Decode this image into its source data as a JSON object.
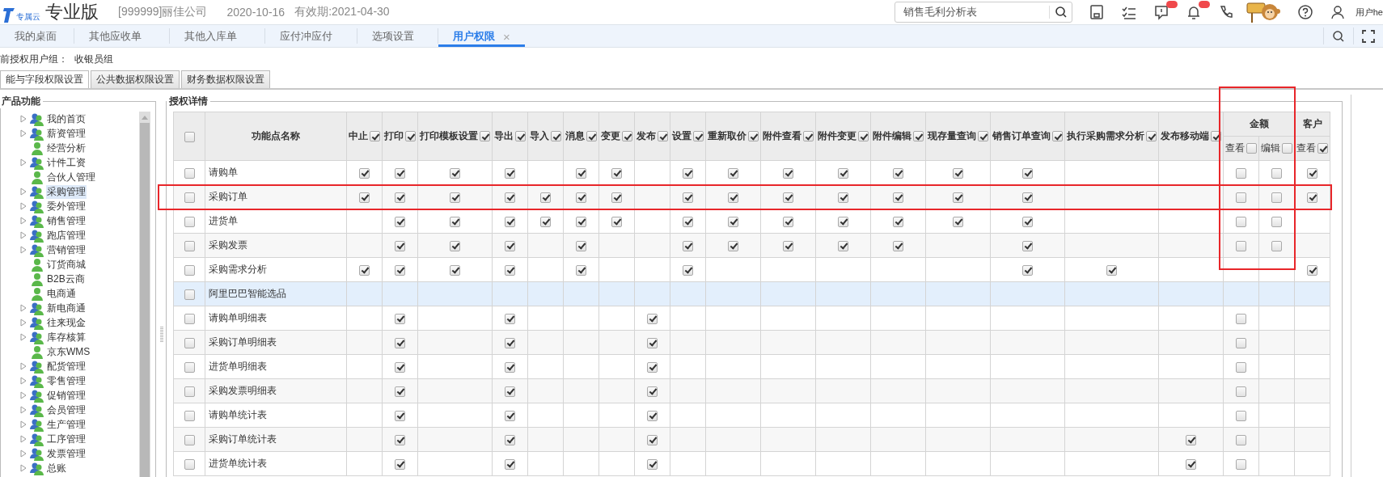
{
  "header": {
    "logo_caption": "专属云",
    "edition": "专业版",
    "company": "[999999]丽佳公司",
    "date": "2020-10-16",
    "validity": "有效期:2021-04-30",
    "search": {
      "value": "销售毛利分析表"
    },
    "user": "用户he"
  },
  "tabs": [
    {
      "label": "我的桌面",
      "selected": false,
      "closable": false
    },
    {
      "label": "其他应收单",
      "selected": false,
      "closable": false
    },
    {
      "label": "其他入库单",
      "selected": false,
      "closable": false
    },
    {
      "label": "应付冲应付",
      "selected": false,
      "closable": false
    },
    {
      "label": "选项设置",
      "selected": false,
      "closable": false
    },
    {
      "label": "用户权限",
      "selected": true,
      "closable": true,
      "close_glyph": "×"
    }
  ],
  "group_line": {
    "label": "前授权用户组：",
    "value": "收银员组"
  },
  "subtabs": [
    {
      "label": "能与字段权限设置",
      "selected": true
    },
    {
      "label": "公共数据权限设置",
      "selected": false
    },
    {
      "label": "财务数据权限设置",
      "selected": false
    }
  ],
  "tree": {
    "title": "产品功能",
    "items": [
      {
        "label": "我的首页",
        "kind": "folder",
        "selected": false
      },
      {
        "label": "薪资管理",
        "kind": "folder",
        "selected": false
      },
      {
        "label": "经营分析",
        "kind": "leaf",
        "selected": false
      },
      {
        "label": "计件工资",
        "kind": "folder",
        "selected": false
      },
      {
        "label": "合伙人管理",
        "kind": "leaf",
        "selected": false
      },
      {
        "label": "采购管理",
        "kind": "folder",
        "selected": true
      },
      {
        "label": "委外管理",
        "kind": "folder",
        "selected": false
      },
      {
        "label": "销售管理",
        "kind": "folder",
        "selected": false
      },
      {
        "label": "跑店管理",
        "kind": "folder",
        "selected": false
      },
      {
        "label": "营销管理",
        "kind": "folder",
        "selected": false
      },
      {
        "label": "订货商城",
        "kind": "leaf",
        "selected": false
      },
      {
        "label": "B2B云商",
        "kind": "leaf",
        "selected": false
      },
      {
        "label": "电商通",
        "kind": "leaf",
        "selected": false
      },
      {
        "label": "新电商通",
        "kind": "folder",
        "selected": false
      },
      {
        "label": "往来现金",
        "kind": "folder",
        "selected": false
      },
      {
        "label": "库存核算",
        "kind": "folder",
        "selected": false
      },
      {
        "label": "京东WMS",
        "kind": "leaf",
        "selected": false
      },
      {
        "label": "配货管理",
        "kind": "folder",
        "selected": false
      },
      {
        "label": "零售管理",
        "kind": "folder",
        "selected": false
      },
      {
        "label": "促销管理",
        "kind": "folder",
        "selected": false
      },
      {
        "label": "会员管理",
        "kind": "folder",
        "selected": false
      },
      {
        "label": "生产管理",
        "kind": "folder",
        "selected": false
      },
      {
        "label": "工序管理",
        "kind": "folder",
        "selected": false
      },
      {
        "label": "发票管理",
        "kind": "folder",
        "selected": false
      },
      {
        "label": "总账",
        "kind": "folder",
        "selected": false
      }
    ]
  },
  "table": {
    "title": "授权详情",
    "select_all": {
      "checked": false
    },
    "name_column": "功能点名称",
    "columns": [
      {
        "label": "中止",
        "checked": true
      },
      {
        "label": "打印",
        "checked": true
      },
      {
        "label": "打印模板设置",
        "checked": true
      },
      {
        "label": "导出",
        "checked": true
      },
      {
        "label": "导入",
        "checked": true
      },
      {
        "label": "消息",
        "checked": true
      },
      {
        "label": "变更",
        "checked": true
      },
      {
        "label": "发布",
        "checked": true
      },
      {
        "label": "设置",
        "checked": true
      },
      {
        "label": "重新取价",
        "checked": true
      },
      {
        "label": "附件查看",
        "checked": true
      },
      {
        "label": "附件变更",
        "checked": true
      },
      {
        "label": "附件编辑",
        "checked": true
      },
      {
        "label": "现存量查询",
        "checked": true
      },
      {
        "label": "销售订单查询",
        "checked": true
      },
      {
        "label": "执行采购需求分析",
        "checked": true
      },
      {
        "label": "发布移动端",
        "checked": true
      }
    ],
    "column_groups": [
      {
        "label": "金额",
        "framed": true,
        "columns": [
          {
            "label": "查看",
            "checked": false
          },
          {
            "label": "编辑",
            "checked": false
          }
        ]
      },
      {
        "label": "客户",
        "framed": false,
        "columns": [
          {
            "label": "查看",
            "checked": true
          }
        ]
      }
    ],
    "rows": [
      {
        "name": "请购单",
        "checked": false,
        "selected": false,
        "framed": false,
        "in_column_frame": true,
        "cells": [
          true,
          true,
          true,
          true,
          null,
          true,
          true,
          null,
          true,
          true,
          true,
          true,
          true,
          true,
          true,
          null,
          null,
          false,
          false,
          true
        ]
      },
      {
        "name": "采购订单",
        "checked": false,
        "selected": false,
        "framed": true,
        "in_column_frame": true,
        "cells": [
          true,
          true,
          true,
          true,
          true,
          true,
          true,
          null,
          true,
          true,
          true,
          true,
          true,
          true,
          true,
          null,
          null,
          false,
          false,
          true
        ]
      },
      {
        "name": "进货单",
        "checked": false,
        "selected": false,
        "framed": false,
        "in_column_frame": true,
        "cells": [
          null,
          true,
          true,
          true,
          true,
          true,
          true,
          null,
          true,
          true,
          true,
          true,
          true,
          true,
          true,
          null,
          null,
          false,
          false,
          null
        ]
      },
      {
        "name": "采购发票",
        "checked": false,
        "selected": false,
        "framed": false,
        "in_column_frame": true,
        "cells": [
          null,
          true,
          true,
          true,
          null,
          true,
          null,
          null,
          true,
          true,
          true,
          true,
          true,
          null,
          true,
          null,
          null,
          false,
          false,
          null
        ]
      },
      {
        "name": "采购需求分析",
        "checked": false,
        "selected": false,
        "framed": false,
        "in_column_frame": true,
        "cells": [
          true,
          true,
          true,
          true,
          null,
          true,
          null,
          null,
          true,
          null,
          null,
          null,
          null,
          null,
          true,
          true,
          null,
          null,
          null,
          true
        ]
      },
      {
        "name": "阿里巴巴智能选品",
        "checked": false,
        "selected": true,
        "framed": false,
        "in_column_frame": false,
        "cells": [
          null,
          null,
          null,
          null,
          null,
          null,
          null,
          null,
          null,
          null,
          null,
          null,
          null,
          null,
          null,
          null,
          null,
          null,
          null,
          null
        ]
      },
      {
        "name": "请购单明细表",
        "checked": false,
        "selected": false,
        "framed": false,
        "in_column_frame": false,
        "cells": [
          null,
          true,
          null,
          true,
          null,
          null,
          null,
          true,
          null,
          null,
          null,
          null,
          null,
          null,
          null,
          null,
          null,
          false,
          null,
          null
        ]
      },
      {
        "name": "采购订单明细表",
        "checked": false,
        "selected": false,
        "framed": false,
        "in_column_frame": false,
        "cells": [
          null,
          true,
          null,
          true,
          null,
          null,
          null,
          true,
          null,
          null,
          null,
          null,
          null,
          null,
          null,
          null,
          null,
          false,
          null,
          null
        ]
      },
      {
        "name": "进货单明细表",
        "checked": false,
        "selected": false,
        "framed": false,
        "in_column_frame": false,
        "cells": [
          null,
          true,
          null,
          true,
          null,
          null,
          null,
          true,
          null,
          null,
          null,
          null,
          null,
          null,
          null,
          null,
          null,
          false,
          null,
          null
        ]
      },
      {
        "name": "采购发票明细表",
        "checked": false,
        "selected": false,
        "framed": false,
        "in_column_frame": false,
        "cells": [
          null,
          true,
          null,
          true,
          null,
          null,
          null,
          true,
          null,
          null,
          null,
          null,
          null,
          null,
          null,
          null,
          null,
          false,
          null,
          null
        ]
      },
      {
        "name": "请购单统计表",
        "checked": false,
        "selected": false,
        "framed": false,
        "in_column_frame": false,
        "cells": [
          null,
          true,
          null,
          true,
          null,
          null,
          null,
          true,
          null,
          null,
          null,
          null,
          null,
          null,
          null,
          null,
          null,
          false,
          null,
          null
        ]
      },
      {
        "name": "采购订单统计表",
        "checked": false,
        "selected": false,
        "framed": false,
        "in_column_frame": false,
        "cells": [
          null,
          true,
          null,
          true,
          null,
          null,
          null,
          true,
          null,
          null,
          null,
          null,
          null,
          null,
          null,
          null,
          true,
          false,
          null,
          null
        ]
      },
      {
        "name": "进货单统计表",
        "checked": false,
        "selected": false,
        "framed": false,
        "in_column_frame": false,
        "cells": [
          null,
          true,
          null,
          true,
          null,
          null,
          null,
          true,
          null,
          null,
          null,
          null,
          null,
          null,
          null,
          null,
          true,
          false,
          null,
          null
        ]
      }
    ]
  }
}
